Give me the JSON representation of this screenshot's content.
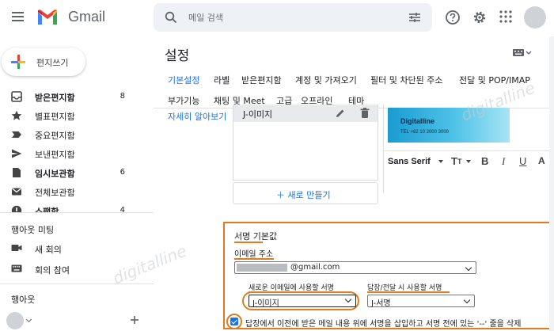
{
  "header": {
    "logo_text": "Gmail",
    "search_placeholder": "메일 검색"
  },
  "sidebar": {
    "compose_label": "편지쓰기",
    "items": [
      {
        "label": "받은편지함",
        "count": "8",
        "bold": true,
        "icon": "inbox-icon"
      },
      {
        "label": "별표편지함",
        "count": "",
        "bold": false,
        "icon": "star-icon"
      },
      {
        "label": "중요편지함",
        "count": "",
        "bold": false,
        "icon": "label-important-icon"
      },
      {
        "label": "보낸편지함",
        "count": "",
        "bold": false,
        "icon": "send-icon"
      },
      {
        "label": "임시보관함",
        "count": "6",
        "bold": true,
        "icon": "draft-icon"
      },
      {
        "label": "전체보관함",
        "count": "",
        "bold": false,
        "icon": "all-mail-icon"
      },
      {
        "label": "스팸함",
        "count": "4",
        "bold": true,
        "icon": "spam-icon"
      }
    ],
    "meet": {
      "title": "행아웃 미팅",
      "new_meeting": "새 회의",
      "join_meeting": "회의 참여"
    },
    "hangouts": {
      "title": "행아웃"
    }
  },
  "settings": {
    "title": "설정",
    "tabs_row1": [
      "기본설정",
      "라벨",
      "받은편지함",
      "계정 및 가져오기",
      "필터 및 차단된 주소",
      "전달 및 POP/IMAP"
    ],
    "tabs_row2": [
      "부가기능",
      "채팅 및 Meet",
      "고급",
      "오프라인",
      "테마"
    ],
    "help_link": "자세히 알아보기",
    "signature_name": "J-이미지",
    "new_signature_button": "새로 만들기",
    "banner": {
      "name": "Digitalline",
      "tel": "TEL  +82 10 2000 3000"
    },
    "font_name": "Sans Serif",
    "defaults": {
      "title": "서명 기본값",
      "email_label": "이메일 주소",
      "email_value": "@gmail.com",
      "new_email_label": "새로운 이메일에 사용할 서명",
      "new_email_value": "J-이미지",
      "reply_label": "답장/전달 시 사용할 서명",
      "reply_value": "J-서명",
      "checkbox_text": "답장에서 이전에 받은 메일 내용 위에 서명을 삽입하고 서명 전에 있는 '--' 줄을 삭제",
      "checkbox_checked": true
    }
  },
  "watermark": "digitalline",
  "colors": {
    "accent": "#1a73e8",
    "highlight": "#e07b1f"
  }
}
